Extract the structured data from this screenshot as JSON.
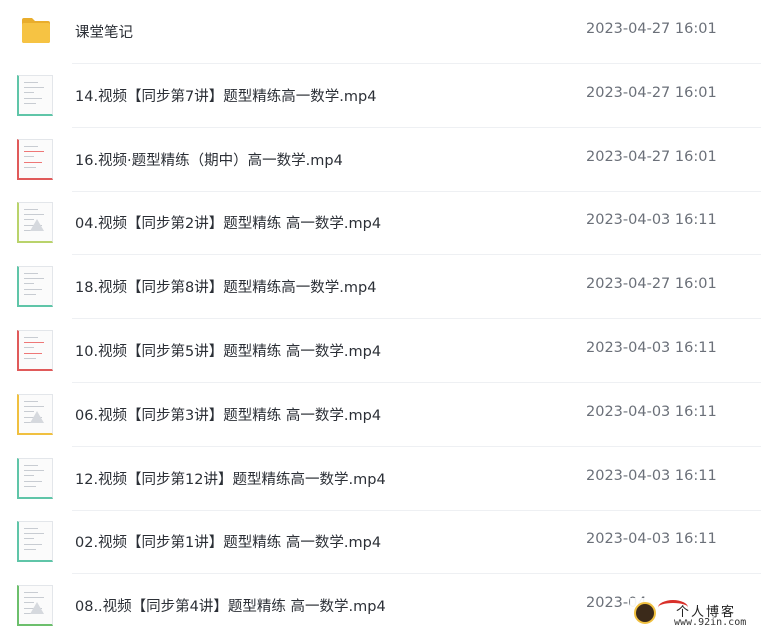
{
  "files": [
    {
      "name": "课堂笔记",
      "date": "2023-04-27 16:01",
      "type": "folder",
      "thumb_accent": "#f6c343",
      "folder_color": "#f6c343"
    },
    {
      "name": "14.视频【同步第7讲】题型精练高一数学.mp4",
      "date": "2023-04-27 16:01",
      "type": "video",
      "thumb_accent": "#5fc5a8"
    },
    {
      "name": "16.视频·题型精练（期中）高一数学.mp4",
      "date": "2023-04-27 16:01",
      "type": "video",
      "thumb_accent": "#e05a5a"
    },
    {
      "name": "04.视频【同步第2讲】题型精练 高一数学.mp4",
      "date": "2023-04-03 16:11",
      "type": "video",
      "thumb_accent": "#b9d36b"
    },
    {
      "name": "18.视频【同步第8讲】题型精练高一数学.mp4",
      "date": "2023-04-27 16:01",
      "type": "video",
      "thumb_accent": "#5fc5a8"
    },
    {
      "name": "10.视频【同步第5讲】题型精练 高一数学.mp4",
      "date": "2023-04-03 16:11",
      "type": "video",
      "thumb_accent": "#e05a5a"
    },
    {
      "name": "06.视频【同步第3讲】题型精练 高一数学.mp4",
      "date": "2023-04-03 16:11",
      "type": "video",
      "thumb_accent": "#f0c040"
    },
    {
      "name": "12.视频【同步第12讲】题型精练高一数学.mp4",
      "date": "2023-04-03 16:11",
      "type": "video",
      "thumb_accent": "#5fc5a8"
    },
    {
      "name": "02.视频【同步第1讲】题型精练 高一数学.mp4",
      "date": "2023-04-03 16:11",
      "type": "video",
      "thumb_accent": "#5fc5a8"
    },
    {
      "name": "08..视频【同步第4讲】题型精练 高一数学.mp4",
      "date": "2023-04-",
      "type": "video",
      "thumb_accent": "#6cbf6c"
    }
  ],
  "watermark": {
    "title": "个人博客",
    "url": "www.92in.com"
  },
  "colors": {
    "text": "#2b2f36",
    "date_text": "#6b7079",
    "divider": "#eef0f3"
  }
}
